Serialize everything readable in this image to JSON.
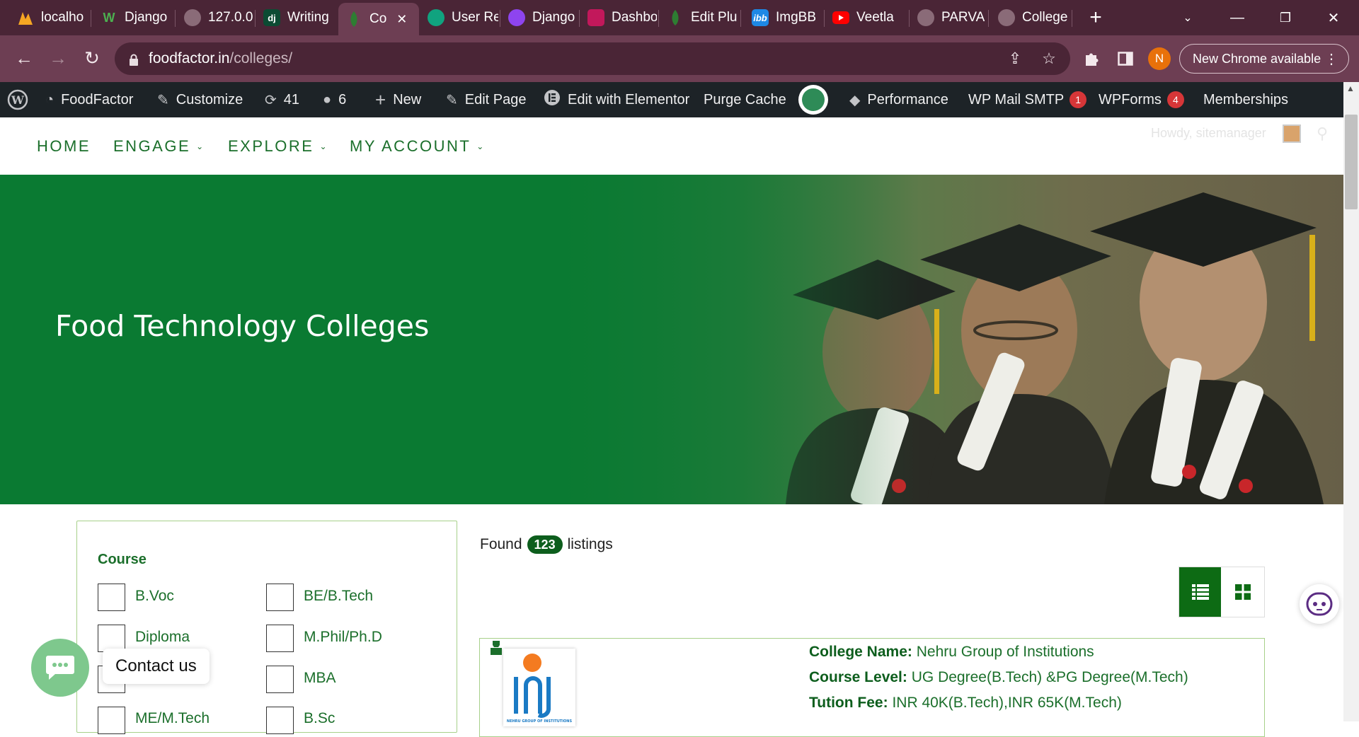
{
  "browser": {
    "tabs": [
      {
        "label": "localho",
        "icon": "tools-icon"
      },
      {
        "label": "Django",
        "icon": "w-icon"
      },
      {
        "label": "127.0.0",
        "icon": "globe-icon"
      },
      {
        "label": "Writing",
        "icon": "dj-icon"
      },
      {
        "label": "Co",
        "icon": "leaf-icon",
        "active": true
      },
      {
        "label": "User Re",
        "icon": "openai-icon"
      },
      {
        "label": "Django",
        "icon": "u-icon"
      },
      {
        "label": "Dashbo",
        "icon": "dashboard-icon"
      },
      {
        "label": "Edit Plu",
        "icon": "leaf-icon"
      },
      {
        "label": "ImgBB",
        "icon": "ibb-icon"
      },
      {
        "label": "Veetla",
        "icon": "youtube-icon"
      },
      {
        "label": "PARVA",
        "icon": "globe-icon"
      },
      {
        "label": "College",
        "icon": "globe-icon"
      }
    ],
    "fav_texts": {
      "dj": "dj",
      "ibb": "ibb",
      "w": "W"
    },
    "url_domain": "foodfactor.in",
    "url_path": "/colleges/",
    "profile_initial": "N",
    "new_chrome_label": "New Chrome available"
  },
  "admin_bar": {
    "site": "FoodFactor",
    "customize": "Customize",
    "updates": "41",
    "comments": "6",
    "new": "New",
    "edit_page": "Edit Page",
    "edit_elementor": "Edit with Elementor",
    "purge_cache": "Purge Cache",
    "performance": "Performance",
    "wp_mail": "WP Mail SMTP",
    "wp_mail_badge": "1",
    "wpforms": "WPForms",
    "wpforms_badge": "4",
    "memberships": "Memberships"
  },
  "site_nav": {
    "items": [
      "HOME",
      "ENGAGE",
      "EXPLORE",
      "MY ACCOUNT"
    ],
    "howdy": "Howdy, sitemanager"
  },
  "hero": {
    "title": "Food Technology Colleges"
  },
  "filter": {
    "title": "Course",
    "options": [
      "B.Voc",
      "BE/B.Tech",
      "Diploma",
      "M.Phil/Ph.D",
      "",
      "MBA",
      "ME/M.Tech",
      "B.Sc"
    ]
  },
  "listings": {
    "found_prefix": "Found",
    "count": "123",
    "found_suffix": "listings",
    "card": {
      "name_label": "College Name:",
      "name_value": "Nehru Group of Institutions",
      "level_label": "Course Level:",
      "level_value": "UG Degree(B.Tech) &PG Degree(M.Tech)",
      "fee_label": "Tution Fee:",
      "fee_value": "INR 40K(B.Tech),INR 65K(M.Tech)",
      "logo_text": "NEHRU GROUP OF INSTITUTIONS"
    }
  },
  "widgets": {
    "contact_label": "Contact us"
  },
  "colors": {
    "brand_green": "#1b6f2b",
    "admin_bar": "#1d2327",
    "chrome_frame": "#4a2536",
    "badge": "#d63638"
  }
}
